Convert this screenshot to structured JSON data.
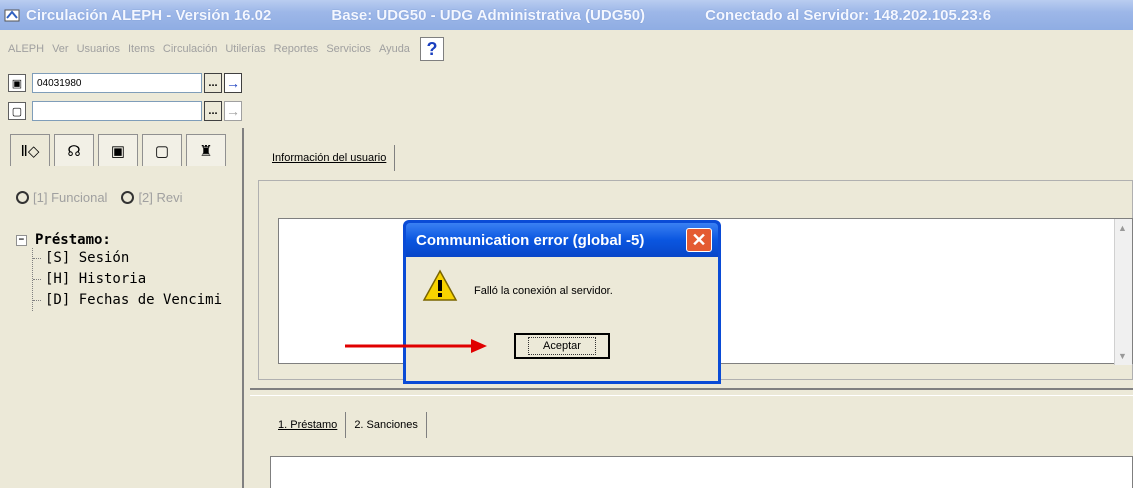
{
  "titlebar": {
    "app": "Circulación ALEPH - Versión 16.02",
    "base": "Base: UDG50 - UDG Administrativa (UDG50)",
    "server": "Conectado al Servidor: 148.202.105.23:6"
  },
  "menu": {
    "items": [
      "ALEPH",
      "Ver",
      "Usuarios",
      "Items",
      "Circulación",
      "Utilerías",
      "Reportes",
      "Servicios",
      "Ayuda"
    ],
    "help": "?"
  },
  "toolbar": {
    "patron_id_value": "04031980",
    "item_barcode_value": "",
    "dots": "...",
    "go_arrow": "→"
  },
  "left_panel": {
    "tabs": [
      "Ⅱ◇",
      "☊",
      "▣",
      "▢",
      "♜"
    ],
    "radio1": "[1] Funcional",
    "radio2": "[2] Revi",
    "tree_root": "Préstamo:",
    "tree_items": [
      "[S] Sesión",
      "[H] Historia",
      "[D] Fechas de Vencimi"
    ]
  },
  "right_area": {
    "top_tab": "Información del usuario",
    "bottom_tabs": [
      "1. Préstamo",
      "2. Sanciones"
    ]
  },
  "dialog": {
    "title": "Communication error (global -5)",
    "message": "Falló la conexión al servidor.",
    "ok_label": "Aceptar",
    "close": "✕"
  }
}
